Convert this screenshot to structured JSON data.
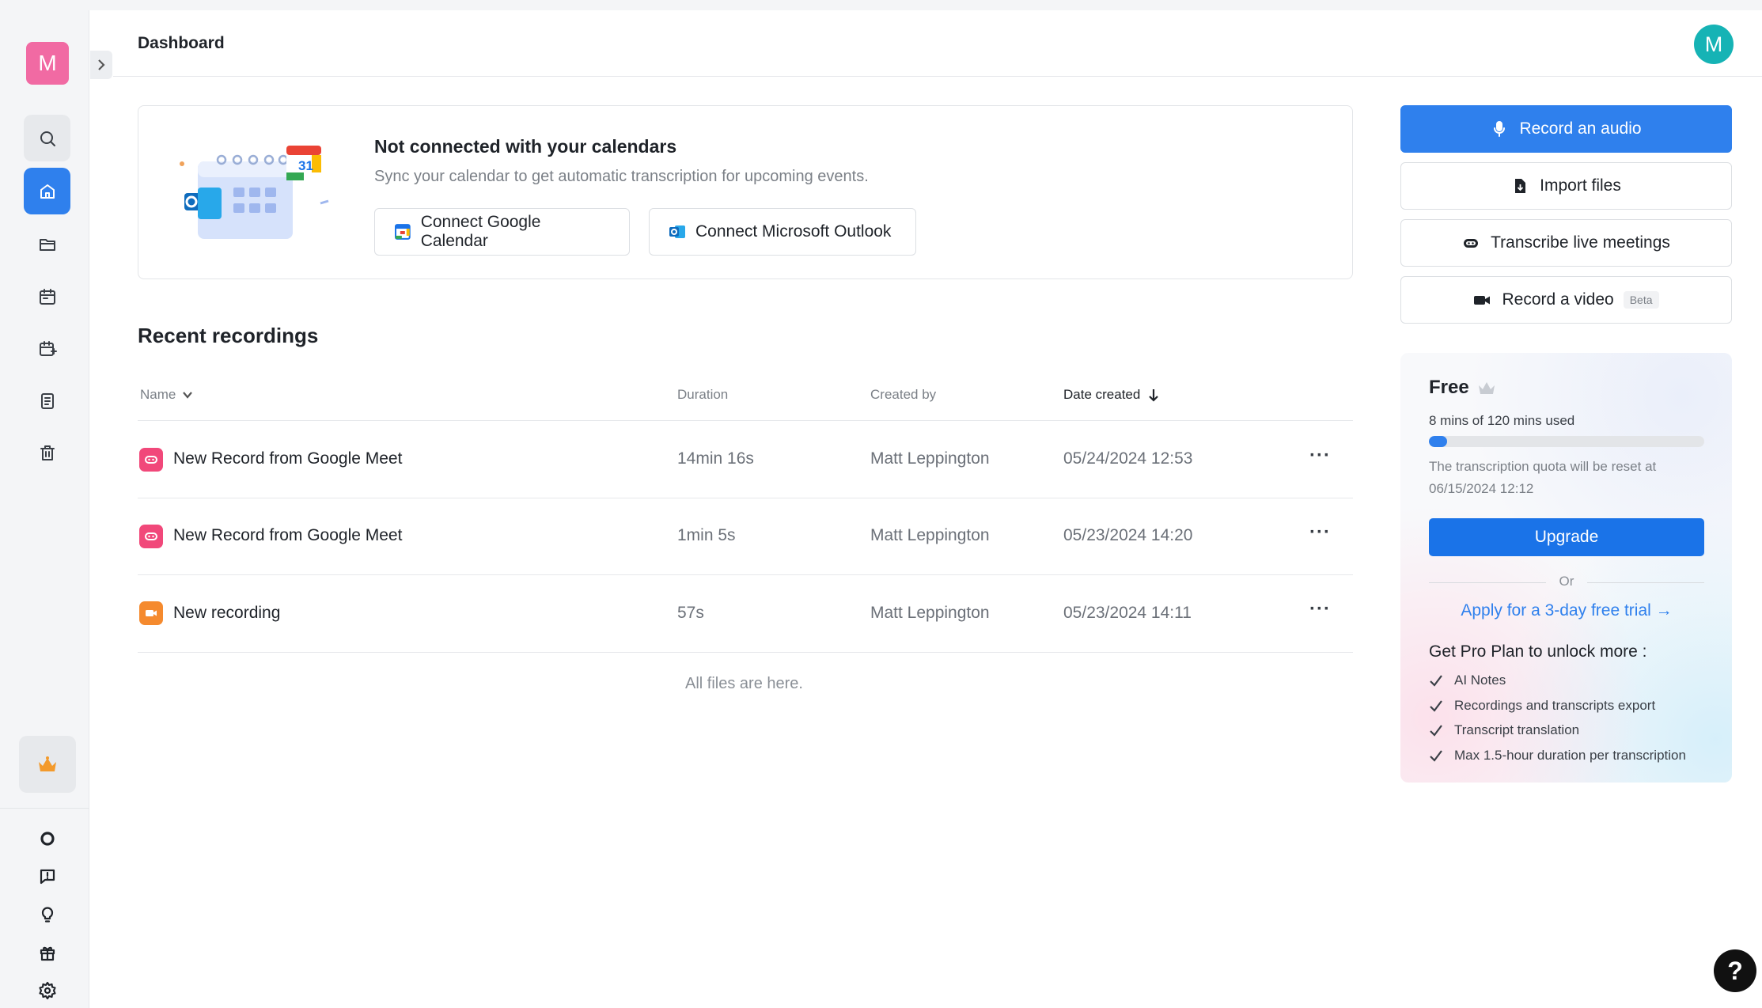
{
  "workspace": {
    "avatar_letter": "M"
  },
  "header": {
    "title": "Dashboard",
    "user_avatar_letter": "M"
  },
  "sidebar": {
    "items": [
      {
        "name": "search",
        "icon": "search-icon"
      },
      {
        "name": "home",
        "icon": "home-icon",
        "active": true
      },
      {
        "name": "files",
        "icon": "folder-icon"
      },
      {
        "name": "calendar",
        "icon": "calendar-icon"
      },
      {
        "name": "schedule",
        "icon": "calendar-edit-icon"
      },
      {
        "name": "notes",
        "icon": "document-icon"
      },
      {
        "name": "trash",
        "icon": "trash-icon"
      }
    ],
    "bottom": [
      "crown-icon",
      "brand-icon",
      "feedback-icon",
      "idea-icon",
      "gift-icon",
      "settings-icon"
    ]
  },
  "calendar_card": {
    "title": "Not connected with your calendars",
    "subtitle": "Sync your calendar to get automatic transcription for upcoming events.",
    "google_button": "Connect Google Calendar",
    "outlook_button": "Connect Microsoft Outlook",
    "calendar_day": "31"
  },
  "recordings": {
    "title": "Recent recordings",
    "columns": {
      "name": "Name",
      "duration": "Duration",
      "created_by": "Created by",
      "date_created": "Date created"
    },
    "rows": [
      {
        "name": "New Record from Google Meet",
        "duration": "14min 16s",
        "created_by": "Matt Leppington",
        "date": "05/24/2024 12:53",
        "type": "meet"
      },
      {
        "name": "New Record from Google Meet",
        "duration": "1min 5s",
        "created_by": "Matt Leppington",
        "date": "05/23/2024 14:20",
        "type": "meet"
      },
      {
        "name": "New recording",
        "duration": "57s",
        "created_by": "Matt Leppington",
        "date": "05/23/2024 14:11",
        "type": "video"
      }
    ],
    "more_label": "···",
    "footer": "All files are here."
  },
  "actions": {
    "record_audio": "Record an audio",
    "import_files": "Import files",
    "transcribe_live": "Transcribe live meetings",
    "record_video": "Record a video",
    "beta": "Beta"
  },
  "plan": {
    "name": "Free",
    "usage": "8 mins of 120 mins used",
    "used_fraction": 0.0667,
    "reset_text": "The transcription quota will be reset at 06/15/2024 12:12",
    "upgrade": "Upgrade",
    "or": "Or",
    "trial": "Apply for a 3-day free trial →",
    "pro_title": "Get Pro Plan to unlock more :",
    "features": [
      "AI Notes",
      "Recordings and transcripts export",
      "Transcript translation",
      "Max 1.5-hour duration per transcription"
    ]
  },
  "help": {
    "label": "?"
  },
  "colors": {
    "accent": "#2f80ed",
    "workspace": "#f16aa3",
    "user": "#16b3b5",
    "meet": "#f1487a",
    "video": "#f58a2e"
  }
}
